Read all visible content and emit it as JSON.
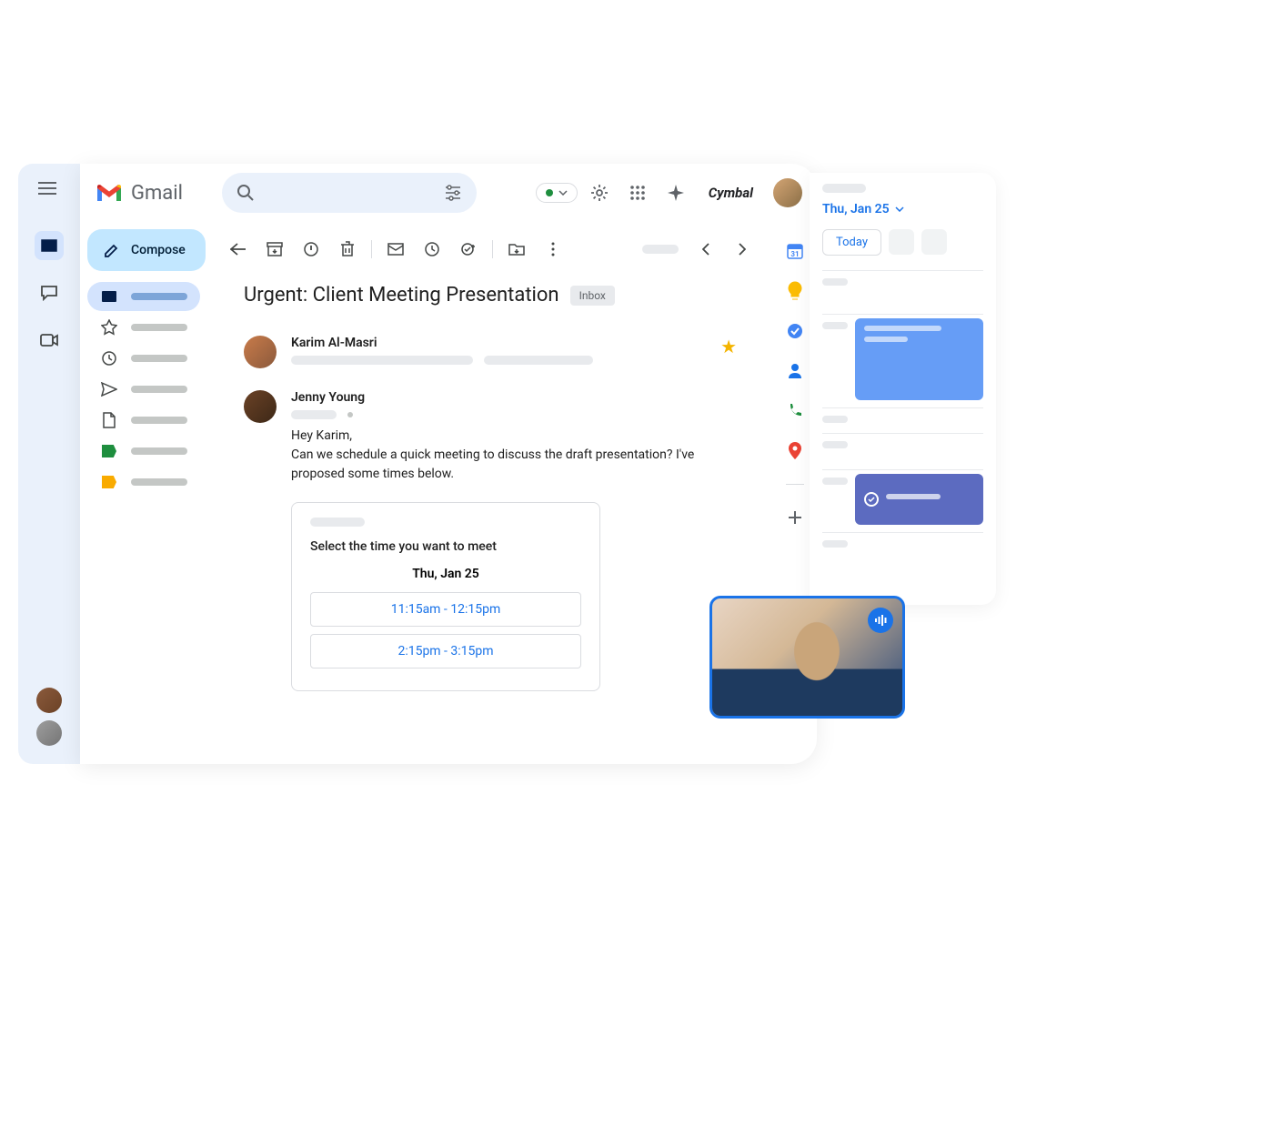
{
  "app": {
    "name": "Gmail",
    "org": "Cymbal"
  },
  "compose": {
    "label": "Compose"
  },
  "toolbar": {},
  "email": {
    "subject": "Urgent: Client Meeting Presentation",
    "folder_badge": "Inbox",
    "senders": [
      {
        "name": "Karim Al-Masri"
      },
      {
        "name": "Jenny Young"
      }
    ],
    "body_greeting": "Hey Karim,",
    "body_text": "Can we schedule a quick meeting to discuss the draft presentation? I've proposed some times below."
  },
  "meeting_card": {
    "title": "Select the time you want to meet",
    "date": "Thu, Jan 25",
    "options": [
      "11:15am - 12:15pm",
      "2:15pm - 3:15pm"
    ]
  },
  "calendar": {
    "date": "Thu, Jan 25",
    "today_label": "Today"
  }
}
